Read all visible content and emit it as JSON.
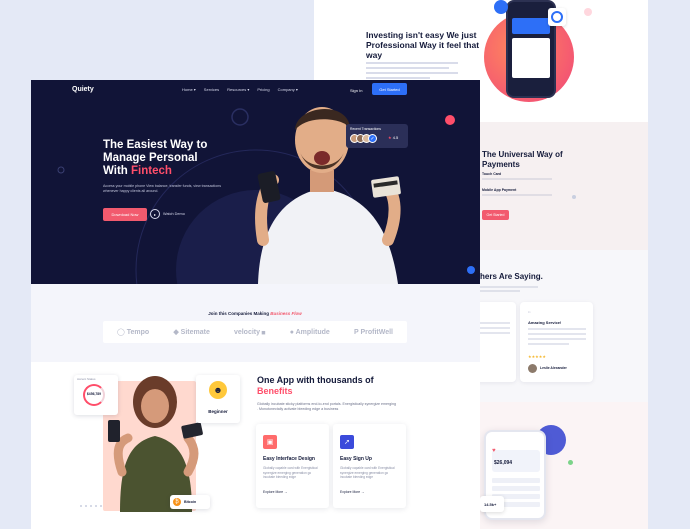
{
  "back": {
    "investing_title": "Investing isn't easy We just Professional Way it feel that way",
    "payments_title": "The Universal Way of Payments",
    "payments_items": [
      "Touch Card",
      "Mobile App Payment"
    ],
    "payments_button": "Get Started",
    "saying_title": "hers Are Saying.",
    "testimonial_title": "Amazing Service!",
    "testimonial_name": "Leslie Alexander",
    "phone_balance": "$26,094",
    "phone_balance2": "14.5k+"
  },
  "nav": {
    "logo": "Quiety",
    "links": [
      "Home ▾",
      "Services",
      "Resources ▾",
      "Pricing",
      "Company ▾"
    ],
    "signin": "Sign In",
    "get_started": "Get Started"
  },
  "hero": {
    "title_line1": "The Easiest Way to",
    "title_line2": "Manage Personal",
    "title_line3": "With",
    "title_highlight": "Fintech",
    "description": "Access your mobile phone View balance, transfer funds, view transactions whenever happy clients all around.",
    "download_button": "Download Now",
    "watch_label": "Watch Demo",
    "transactions_label": "Recent Transactions",
    "rating": "4.5"
  },
  "companies": {
    "heading_prefix": "Join this Companies Making",
    "heading_highlight": "Business Flow",
    "logos": [
      "Tempo",
      "Sitemate",
      "velocity",
      "Amplitude",
      "ProfitWell"
    ]
  },
  "app": {
    "title_line1": "One App with thousands of",
    "title_highlight": "Benefits",
    "description": "Globally incubate sticky platforms end-to-end portals. Energistically synergize emerging . Monotonectally activate bleeding edge a business",
    "features": [
      {
        "title": "Easy Interface Design",
        "desc": "Globally capable card with Energistical synergize emerging generation go incubate bleeding edge",
        "more": "Explore More →"
      },
      {
        "title": "Easy Sign Up",
        "desc": "Globally capable card with Energistical synergize emerging generation go incubate bleeding edge",
        "more": "Explore More →"
      }
    ],
    "card_label": "Accent Status",
    "card_value": "$456,789",
    "badge_role": "Beginner",
    "coin_label": "Bitcoin"
  },
  "colors": {
    "accent": "#f25a6e",
    "primary": "#2d6ff7",
    "dark": "#111437"
  }
}
